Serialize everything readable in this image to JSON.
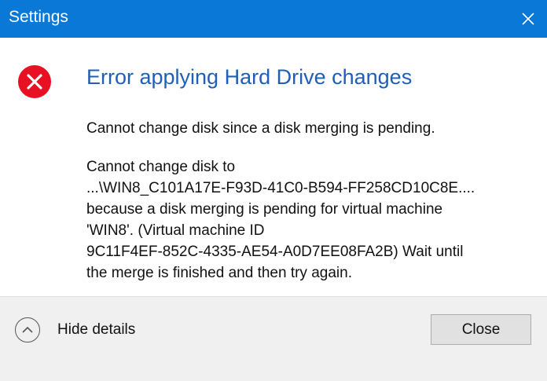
{
  "window": {
    "title": "Settings",
    "close_icon": "close-icon"
  },
  "error": {
    "icon": "error-icon",
    "icon_color": "#e81123",
    "heading": "Error applying Hard Drive changes",
    "summary": "Cannot change disk since a disk merging is pending.",
    "details": [
      "Cannot change disk to",
      "...\\WIN8_C101A17E-F93D-41C0-B594-FF258CD10C8E....",
      "because a disk merging is pending for virtual machine",
      "'WIN8'. (Virtual machine ID",
      "9C11F4EF-852C-4335-AE54-A0D7EE08FA2B) Wait until",
      "the merge is finished and then try again."
    ]
  },
  "footer": {
    "toggle_icon": "chevron-up-icon",
    "toggle_label": "Hide details",
    "close_label": "Close"
  },
  "colors": {
    "titlebar": "#0a78d7",
    "heading": "#1f5fb8",
    "footer": "#f0f0f0"
  }
}
